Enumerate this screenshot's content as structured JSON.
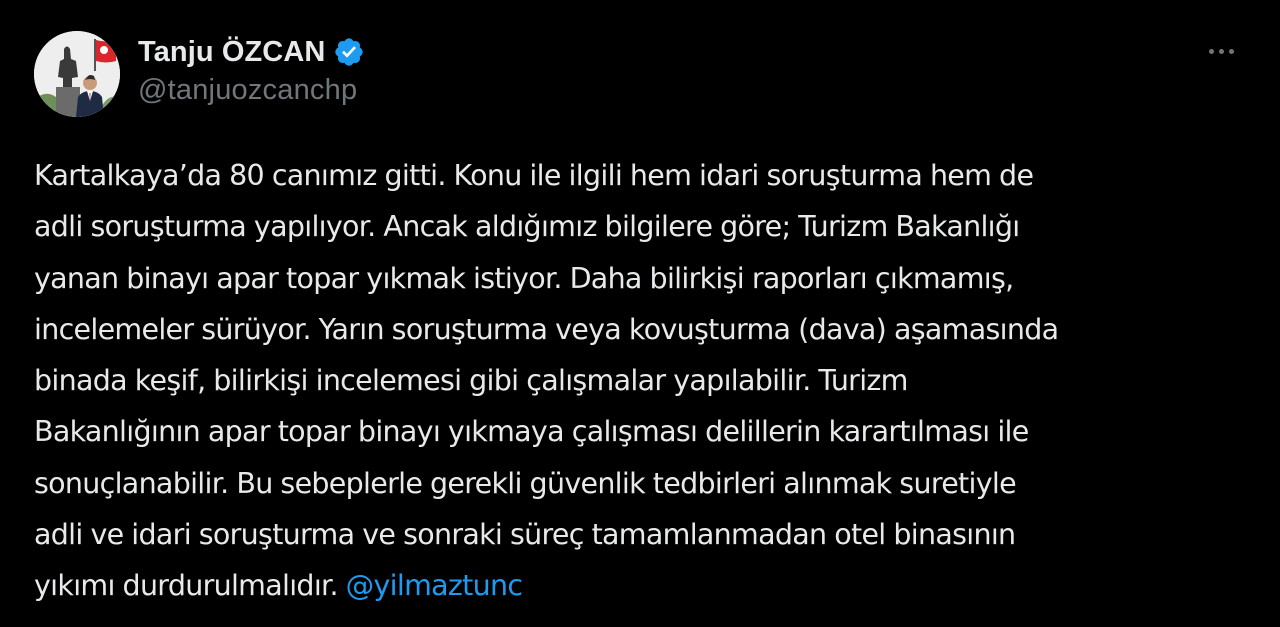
{
  "author": {
    "display_name": "Tanju ÖZCAN",
    "handle": "@tanjuozcanchp",
    "verified": true,
    "verified_color": "#1d9bf0"
  },
  "menu": {
    "icon": "more-horizontal-icon"
  },
  "tweet": {
    "lines": [
      "Kartalkaya’da 80 canımız gitti. Konu ile ilgili hem idari soruşturma hem de",
      "adli soruşturma yapılıyor. Ancak aldığımız bilgilere göre; Turizm Bakanlığı",
      "yanan binayı apar topar yıkmak istiyor. Daha bilirkişi raporları çıkmamış,",
      "incelemeler sürüyor. Yarın soruşturma veya kovuşturma (dava) aşamasında",
      "binada keşif, bilirkişi incelemesi gibi çalışmalar yapılabilir. Turizm",
      "Bakanlığının apar topar binayı yıkmaya çalışması delillerin karartılması ile",
      "sonuçlanabilir. Bu sebeplerle gerekli güvenlik tedbirleri alınmak suretiyle",
      "adli ve idari soruşturma ve sonraki süreç tamamlanmadan otel binasının"
    ],
    "last_line_text": "yıkımı durdurulmalıdır. ",
    "mention": "@yilmaztunc",
    "mention_color": "#1d9bf0"
  }
}
